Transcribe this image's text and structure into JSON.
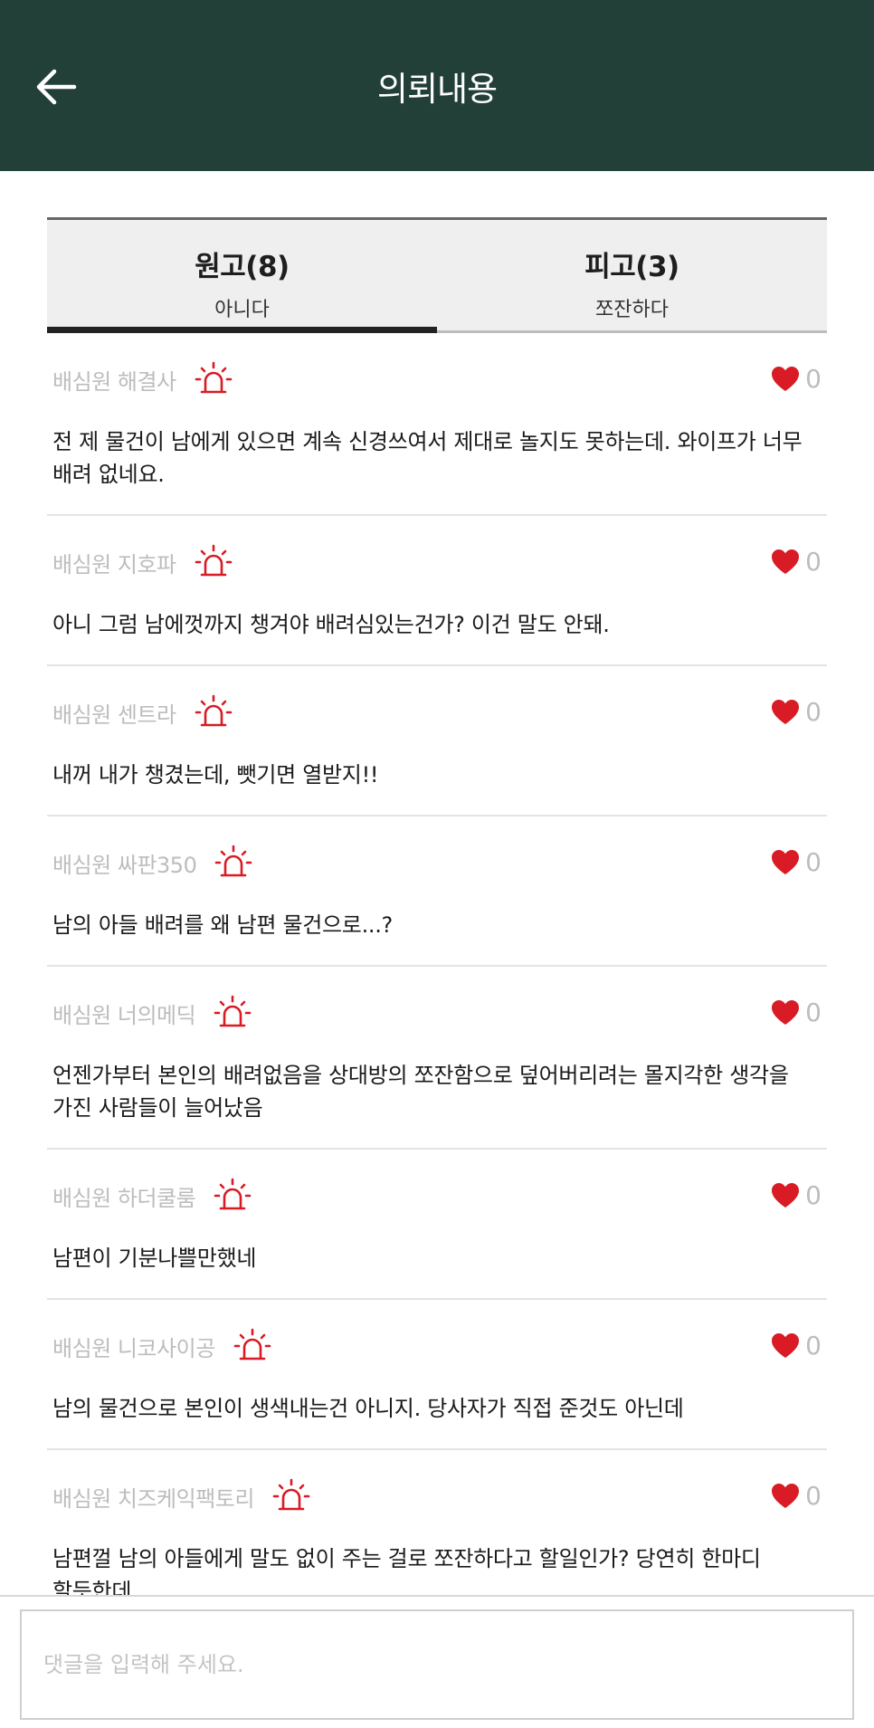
{
  "header": {
    "title": "의뢰내용",
    "back_icon": "arrow-left-icon",
    "background": "#234038"
  },
  "tabs": [
    {
      "name": "원고(8)",
      "sub": "아니다",
      "active": true
    },
    {
      "name": "피고(3)",
      "sub": "쪼잔하다",
      "active": false
    }
  ],
  "comments": [
    {
      "author": "배심원 해결사",
      "likes": "0",
      "text": "전 제 물건이 남에게 있으면 계속 신경쓰여서 제대로 놀지도 못하는데. 와이프가 너무 배려 없네요."
    },
    {
      "author": "배심원 지호파",
      "likes": "0",
      "text": "아니 그럼 남에껏까지 챙겨야 배려심있는건가? 이건 말도 안돼."
    },
    {
      "author": "배심원 센트라",
      "likes": "0",
      "text": "내꺼 내가 챙겼는데, 뺏기면 열받지!!"
    },
    {
      "author": "배심원 싸판350",
      "likes": "0",
      "text": "남의 아들 배려를 왜 남편 물건으로...?"
    },
    {
      "author": "배심원 너의메딕",
      "likes": "0",
      "text": "언젠가부터 본인의 배려없음을 상대방의 쪼잔함으로 덮어버리려는 몰지각한 생각을 가진 사람들이 늘어났음"
    },
    {
      "author": "배심원 하더쿨룸",
      "likes": "0",
      "text": "남편이 기분나쁠만했네"
    },
    {
      "author": "배심원 니코사이공",
      "likes": "0",
      "text": "남의 물건으로 본인이 생색내는건 아니지. 당사자가 직접 준것도 아닌데"
    },
    {
      "author": "배심원 치즈케익팩토리",
      "likes": "0",
      "text": "남편껄 남의 아들에게 말도 없이 주는 걸로 쪼잔하다고 할일인가? 당연히 한마디 할듯한데"
    }
  ],
  "icons": {
    "report": "siren-icon",
    "like": "heart-icon"
  },
  "colors": {
    "accent": "#d81b24",
    "muted": "#bdbdbd"
  },
  "comment_input": {
    "placeholder": "댓글을 입력해 주세요.",
    "value": ""
  }
}
